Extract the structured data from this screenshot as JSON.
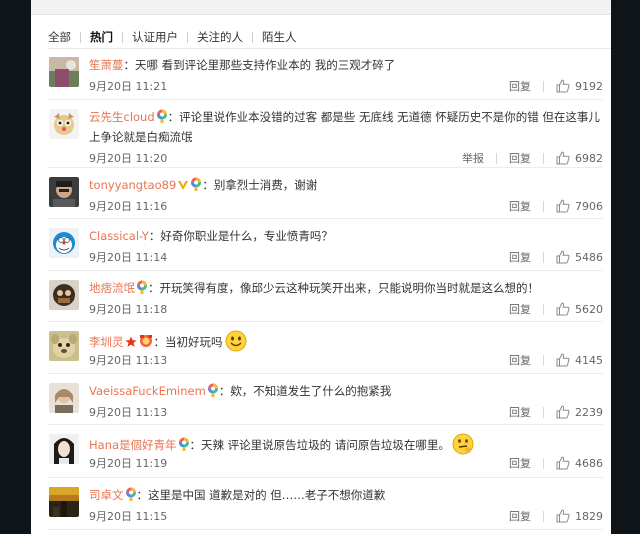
{
  "filters": [
    "全部",
    "热门",
    "认证用户",
    "关注的人",
    "陌生人"
  ],
  "actions": {
    "report": "举报",
    "reply": "回复"
  },
  "colors": {
    "name": "#eb7350",
    "page_bg": "#0f1419",
    "panel_bg": "#ffffff"
  },
  "comments": [
    {
      "user": "笙萧蔓",
      "badges": [],
      "sep": "：",
      "text": "天哪 看到评论里那些支持作业本的 我的三观才碎了",
      "time": "9月20日 11:21",
      "likes": "9192",
      "report": false
    },
    {
      "user": "云先生cloud",
      "badges": [
        "rainbow-badge-icon"
      ],
      "sep": "：",
      "text": "评论里说作业本没错的过客 都是些 无底线 无道德 怀疑历史不是你的错 但在这事儿上争论就是白痴流氓",
      "time": "9月20日 11:20",
      "likes": "6982",
      "report": true
    },
    {
      "user": "tonyyangtao89",
      "badges": [
        "vip-v-badge-icon",
        "rainbow-badge-icon"
      ],
      "sep": "：",
      "text": "别拿烈士消费，谢谢",
      "time": "9月20日 11:16",
      "likes": "7906",
      "report": false
    },
    {
      "user": "Classical-Y",
      "badges": [],
      "sep": "：",
      "text": "好奇你职业是什么，专业愤青吗？",
      "time": "9月20日 11:14",
      "likes": "5486",
      "report": false
    },
    {
      "user": "地痞流氓",
      "badges": [
        "rainbow-badge-icon"
      ],
      "sep": "：",
      "text": "开玩笑得有度，像邱少云这种玩笑开出来，只能说明你当时就是这么想的！",
      "time": "9月20日 11:18",
      "likes": "5620",
      "report": false
    },
    {
      "user": "李圳灵",
      "badges": [
        "red-star-icon",
        "red-medal-icon"
      ],
      "sep": "：",
      "text": "当初好玩吗",
      "emoji": "smile-emoji-icon",
      "time": "9月20日 11:13",
      "likes": "4145",
      "report": false
    },
    {
      "user": "VaeissaFuckEminem",
      "badges": [
        "rainbow-badge-icon"
      ],
      "sep": "：",
      "text": "欸，不知道发生了什么的抱紧我",
      "time": "9月20日 11:13",
      "likes": "2239",
      "report": false
    },
    {
      "user": "Hana是個好青年",
      "badges": [
        "rainbow-badge-icon"
      ],
      "sep": "：",
      "text": "天辣 评论里说原告垃圾的 请问原告垃圾在哪里。",
      "emoji": "thinking-emoji-icon",
      "time": "9月20日 11:19",
      "likes": "4686",
      "report": false
    },
    {
      "user": "司卓文",
      "badges": [
        "rainbow-badge-icon"
      ],
      "sep": "：",
      "text": "这里是中国 道歉是对的 但……老子不想你道歉",
      "time": "9月20日 11:15",
      "likes": "1829",
      "report": false
    }
  ]
}
